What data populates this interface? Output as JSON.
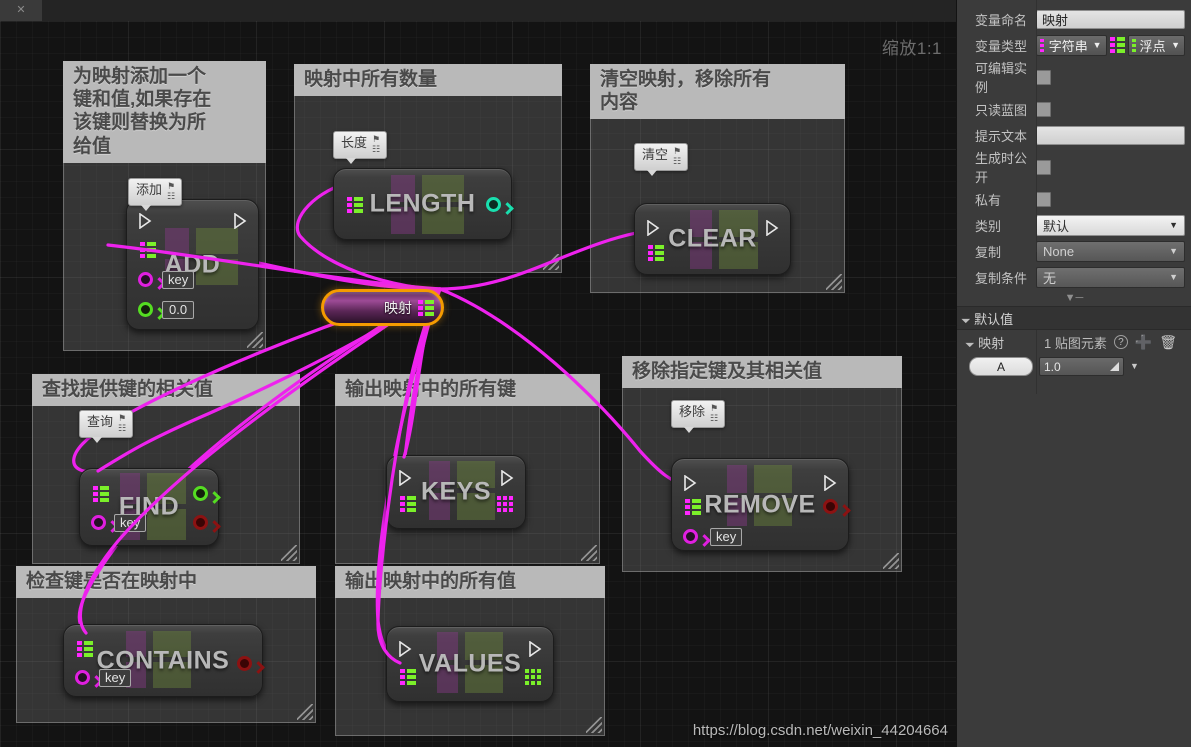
{
  "window": {
    "tab_close_icon": "close-icon"
  },
  "canvas": {
    "zoom_label": "缩放1:1",
    "watermark": "https://blog.csdn.net/weixin_44204664"
  },
  "comments": [
    {
      "id": "add",
      "title": "为映射添加一个\n键和值,如果存在\n该键则替换为所\n给值"
    },
    {
      "id": "length",
      "title": "映射中所有数量"
    },
    {
      "id": "clear",
      "title": "清空映射，移除所有\n内容"
    },
    {
      "id": "find",
      "title": "查找提供键的相关值"
    },
    {
      "id": "keys",
      "title": "输出映射中的所有键"
    },
    {
      "id": "remove",
      "title": "移除指定键及其相关值"
    },
    {
      "id": "contains",
      "title": "检查键是否在映射中"
    },
    {
      "id": "values",
      "title": "输出映射中的所有值"
    }
  ],
  "badges": [
    {
      "id": "add",
      "label": "添加"
    },
    {
      "id": "length",
      "label": "长度"
    },
    {
      "id": "clear",
      "label": "清空"
    },
    {
      "id": "find",
      "label": "查询"
    },
    {
      "id": "remove",
      "label": "移除"
    }
  ],
  "nodes": [
    {
      "id": "add",
      "title": "ADD",
      "key_label": "key",
      "value_label": "0.0"
    },
    {
      "id": "length",
      "title": "LENGTH"
    },
    {
      "id": "clear",
      "title": "CLEAR"
    },
    {
      "id": "find",
      "title": "FIND",
      "key_label": "key"
    },
    {
      "id": "keys",
      "title": "KEYS"
    },
    {
      "id": "remove",
      "title": "REMOVE",
      "key_label": "key"
    },
    {
      "id": "contains",
      "title": "CONTAINS",
      "key_label": "key"
    },
    {
      "id": "values",
      "title": "VALUES"
    }
  ],
  "variable_node": {
    "label": "映射"
  },
  "panel": {
    "rows": {
      "name_label": "变量命名",
      "name_value": "映射",
      "type_label": "变量类型",
      "type_key": "字符串",
      "type_value": "浮点",
      "editable_instance_label": "可编辑实例",
      "blueprint_readonly_label": "只读蓝图",
      "tooltip_label": "提示文本",
      "tooltip_value": "",
      "expose_on_spawn_label": "生成时公开",
      "private_label": "私有",
      "category_label": "类别",
      "category_value": "默认",
      "replication_label": "复制",
      "replication_value": "None",
      "replication_condition_label": "复制条件",
      "replication_condition_value": "无"
    },
    "default_section": {
      "header": "默认值",
      "map_label": "映射",
      "element_count": "1 贴图元素",
      "help_icon": "help-icon",
      "add_icon": "add-icon",
      "delete_icon": "delete-icon",
      "entry_key": "A",
      "entry_value": "1.0"
    }
  },
  "colors": {
    "wire": "#ee22ee",
    "selection": "#f59b00",
    "map_key_pin": "#ff26ff",
    "map_value_pin": "#7bf02a",
    "node_body": "#373737",
    "comment_header": "#b9b9b9",
    "panel_bg": "#3b3b3b"
  }
}
